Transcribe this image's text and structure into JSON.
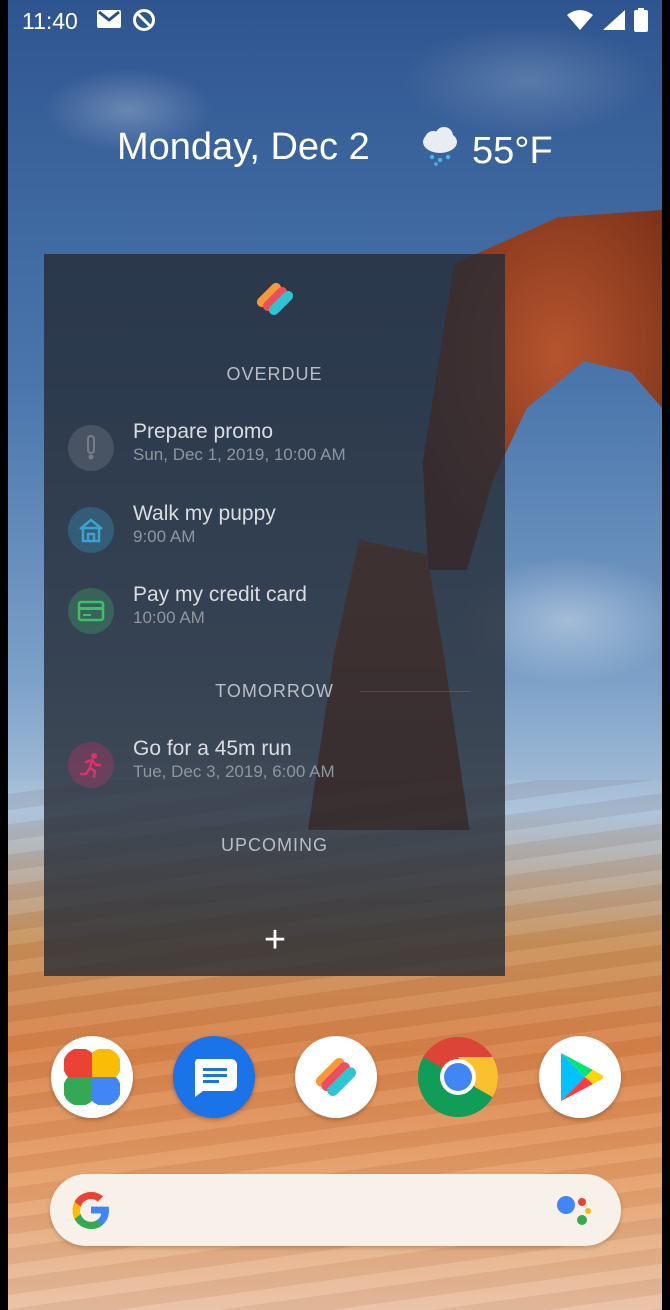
{
  "status_bar": {
    "time": "11:40",
    "icons": [
      "gmail-icon",
      "do-not-disturb-icon",
      "wifi-icon",
      "signal-icon",
      "battery-icon"
    ]
  },
  "at_a_glance": {
    "date": "Monday, Dec 2",
    "temperature": "55°F",
    "weather_icon": "rain-cloud-icon"
  },
  "widget": {
    "logo_icon": "any-do-logo-icon",
    "sections": [
      {
        "label": "OVERDUE",
        "tasks": [
          {
            "title": "Prepare promo",
            "subtitle": "Sun, Dec 1, 2019, 10:00 AM",
            "icon": "exclamation-icon",
            "color": "#6b7280"
          },
          {
            "title": "Walk my puppy",
            "subtitle": "9:00 AM",
            "icon": "dog-house-icon",
            "color": "#3ba3d4"
          },
          {
            "title": "Pay my credit card",
            "subtitle": "10:00 AM",
            "icon": "credit-card-icon",
            "color": "#3fbf6a"
          }
        ]
      },
      {
        "label": "TOMORROW",
        "tasks": [
          {
            "title": "Go for a 45m run",
            "subtitle": "Tue, Dec 3, 2019, 6:00 AM",
            "icon": "runner-icon",
            "color": "#e0306a"
          }
        ]
      },
      {
        "label": "UPCOMING",
        "tasks": []
      }
    ],
    "add_label": "+"
  },
  "dock": {
    "apps": [
      "google-photos-icon",
      "messages-icon",
      "any-do-icon",
      "chrome-icon",
      "play-store-icon"
    ]
  },
  "search_bar": {
    "left_icon": "google-g-icon",
    "right_icon": "google-assistant-icon"
  }
}
